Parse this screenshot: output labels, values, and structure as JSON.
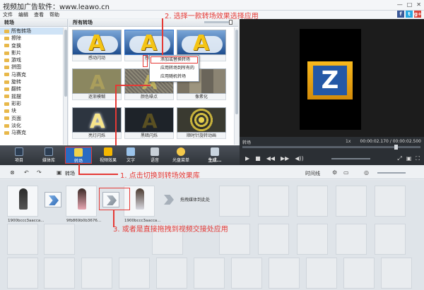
{
  "window": {
    "title": "视频加广告软件：www.leawo.cn",
    "menus": [
      "文件",
      "编辑",
      "查看",
      "帮助"
    ],
    "social": [
      "f",
      "t",
      "g+"
    ]
  },
  "categories": {
    "header": "转场",
    "items": [
      "所有转场",
      "擦除",
      "变换",
      "影片",
      "游戏",
      "拼图",
      "马赛克",
      "旋转",
      "翻转",
      "摇摆",
      "彩彩",
      "块",
      "页面",
      "淡化",
      "马赛克"
    ]
  },
  "gallery": {
    "header": "所有转场",
    "tiles": [
      {
        "caption": "感动闪动",
        "style": "letterA"
      },
      {
        "caption": "感动",
        "style": "letterA"
      },
      {
        "caption": "",
        "style": "letterA"
      },
      {
        "caption": "逐渐模糊",
        "style": "blurred"
      },
      {
        "caption": "颜色噪点",
        "style": "dots"
      },
      {
        "caption": "像素化",
        "style": "mosaic"
      },
      {
        "caption": "亮灯闪烁",
        "style": "bright"
      },
      {
        "caption": "黑暗闪烁",
        "style": "dark"
      },
      {
        "caption": "顺时针旋转动画",
        "style": "swirl"
      }
    ]
  },
  "context_menu": {
    "items": [
      "添加或替换转场",
      "应用转场到所有的",
      "应用随机转场"
    ]
  },
  "preview": {
    "letter": "Z",
    "label": "转场",
    "speed": "1x",
    "time": "00:00:02.170 / 00:00:02.500",
    "controls": [
      "▶",
      "■",
      "◀◀",
      "▶▶",
      "◀))"
    ],
    "right_controls": [
      "⤢",
      "▣",
      "⛶"
    ]
  },
  "toolbar": {
    "buttons": [
      "项目",
      "媒体库",
      "转场",
      "视频效果",
      "文字",
      "语音",
      "光盘菜单",
      "生成..."
    ]
  },
  "timeline": {
    "header_label": "转场",
    "axis_label": "时间线",
    "clips": [
      {
        "caption": "1900bccc3aacca...",
        "figure": "dark"
      },
      {
        "caption": "9fb869b0b3676...",
        "figure": "pink"
      },
      {
        "caption": "1900bccc3aacca...",
        "figure": "light"
      }
    ],
    "drop_text": "拖拽媒体到此处"
  },
  "annotations": {
    "step1": "1. 点击切换到转场效果库",
    "step2": "2. 选择一款转场效果选择应用",
    "step3": "3. 或者是直接拖拽到视频交接处应用"
  },
  "colors": {
    "annotation": "#e53935",
    "selection": "#2a6bc2",
    "toolbar": "#3b4047"
  }
}
